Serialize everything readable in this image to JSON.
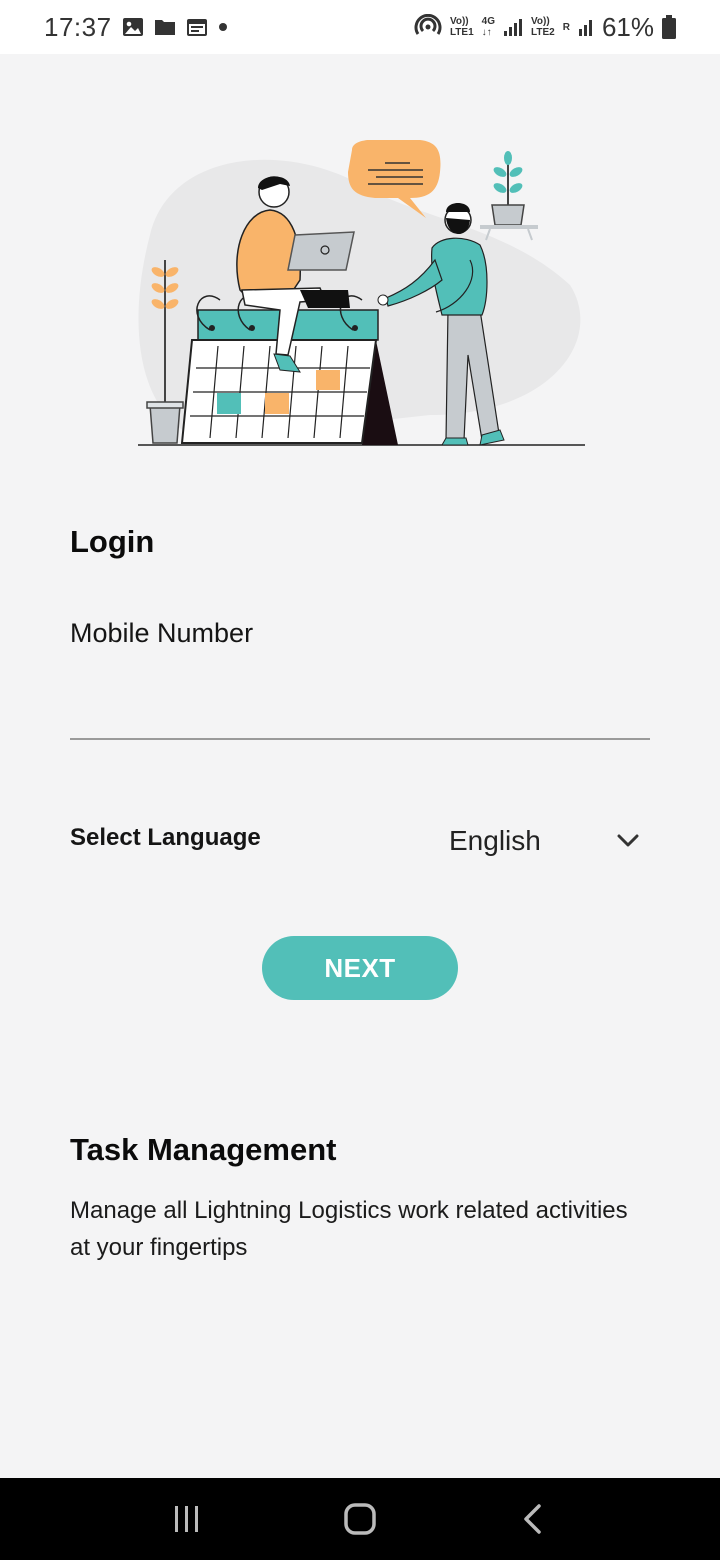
{
  "status_bar": {
    "time": "17:37",
    "sim1_top": "Vo))",
    "sim1_bottom": "LTE1",
    "net_top": "4G",
    "net_bottom": "↓↑",
    "sim2_top": "Vo))",
    "sim2_bottom": "LTE2",
    "roaming": "R",
    "battery": "61%",
    "icons": [
      "image-icon",
      "folder-icon",
      "calendar-icon",
      "dot-icon",
      "hotspot-icon",
      "signal-icon",
      "battery-icon"
    ]
  },
  "login": {
    "title": "Login",
    "mobile_label": "Mobile Number",
    "mobile_value": "",
    "language_label": "Select Language",
    "language_value": "English",
    "next_label": "NEXT"
  },
  "info": {
    "title": "Task Management",
    "description": "Manage all Lightning Logistics work related activities at your fingertips"
  },
  "colors": {
    "accent": "#52bfb8",
    "orange": "#f9b46a",
    "background": "#f4f4f5"
  },
  "nav_bar": {
    "icons": [
      "recent-apps-icon",
      "home-icon",
      "back-icon"
    ]
  }
}
